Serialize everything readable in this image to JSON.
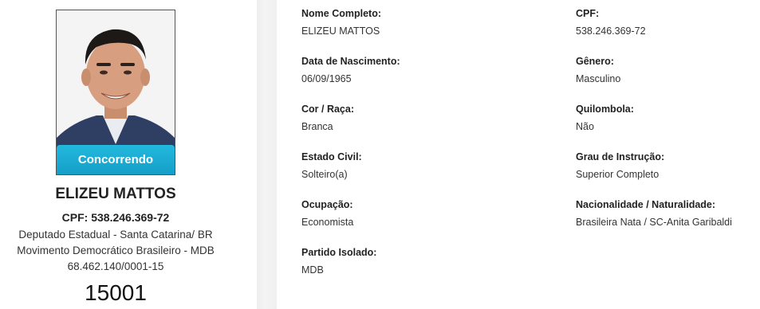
{
  "candidate": {
    "status_badge": "Concorrendo",
    "name": "ELIZEU MATTOS",
    "cpf_line": "CPF: 538.246.369-72",
    "office": "Deputado Estadual - Santa Catarina/ BR",
    "party": "Movimento Democrático Brasileiro - MDB",
    "cnpj": "68.462.140/0001-15",
    "number": "15001"
  },
  "details": {
    "nome_completo": {
      "label": "Nome Completo:",
      "value": "ELIZEU MATTOS"
    },
    "cpf": {
      "label": "CPF:",
      "value": "538.246.369-72"
    },
    "data_nascimento": {
      "label": "Data de Nascimento:",
      "value": "06/09/1965"
    },
    "genero": {
      "label": "Gênero:",
      "value": "Masculino"
    },
    "cor_raca": {
      "label": "Cor / Raça:",
      "value": "Branca"
    },
    "quilombola": {
      "label": "Quilombola:",
      "value": "Não"
    },
    "estado_civil": {
      "label": "Estado Civil:",
      "value": "Solteiro(a)"
    },
    "grau_instrucao": {
      "label": "Grau de Instrução:",
      "value": "Superior Completo"
    },
    "ocupacao": {
      "label": "Ocupação:",
      "value": "Economista"
    },
    "nacionalidade": {
      "label": "Nacionalidade / Naturalidade:",
      "value": "Brasileira Nata / SC-Anita Garibaldi"
    },
    "partido_isolado": {
      "label": "Partido Isolado:",
      "value": "MDB"
    }
  },
  "colors": {
    "badge": "#1aaad3",
    "divider": "#eeeeee"
  }
}
